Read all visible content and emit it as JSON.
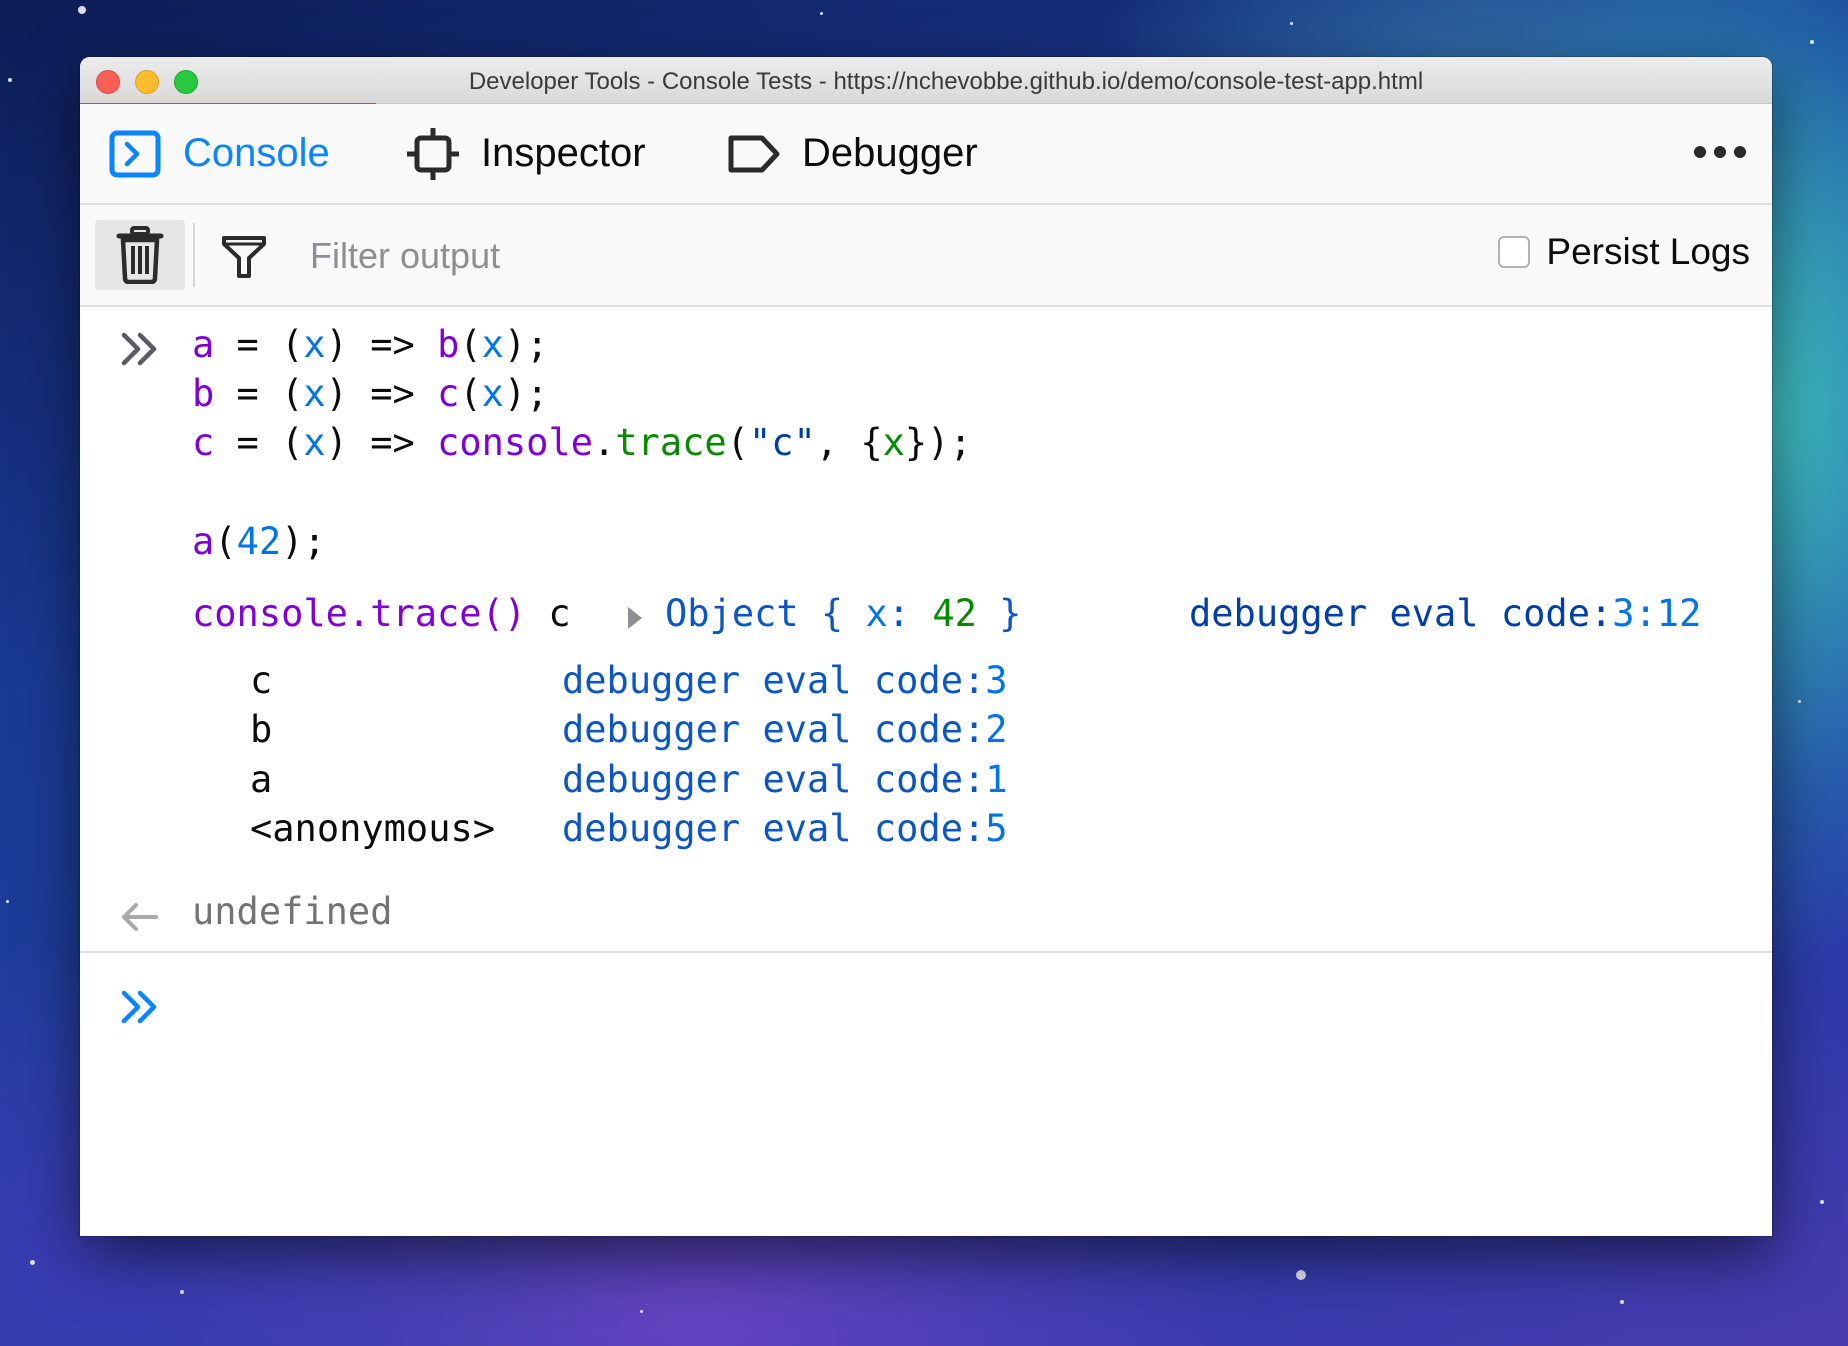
{
  "window": {
    "title": "Developer Tools - Console Tests - https://nchevobbe.github.io/demo/console-test-app.html"
  },
  "tabs": [
    {
      "label": "Console",
      "icon": "console-icon",
      "active": true
    },
    {
      "label": "Inspector",
      "icon": "inspector-icon",
      "active": false
    },
    {
      "label": "Debugger",
      "icon": "debugger-icon",
      "active": false
    }
  ],
  "toolbar": {
    "filter_placeholder": "Filter output",
    "persist_logs_label": "Persist Logs",
    "persist_logs_checked": false
  },
  "console": {
    "input_code": {
      "line1": {
        "lhs": "a",
        "eq": " = (",
        "param": "x",
        "arrow": ") => ",
        "fn": "b",
        "open": "(",
        "arg": "x",
        "close": ");"
      },
      "line2": {
        "lhs": "b",
        "eq": " = (",
        "param": "x",
        "arrow": ") => ",
        "fn": "c",
        "open": "(",
        "arg": "x",
        "close": ");"
      },
      "line3": {
        "lhs": "c",
        "eq": " = (",
        "param": "x",
        "arrow": ") => ",
        "fn": "console",
        "dot": ".",
        "method": "trace",
        "open": "(",
        "str": "\"c\"",
        "comma": ", {",
        "arg": "x",
        "close": "});"
      },
      "line4": {
        "fn": "a",
        "open": "(",
        "num": "42",
        "close": ");"
      }
    },
    "trace": {
      "label": "console.trace()",
      "message": "c",
      "object_prefix": "Object { ",
      "object_key": "x",
      "object_sep": ": ",
      "object_value": "42",
      "object_suffix": " }",
      "location_text": "debugger eval code:",
      "location_pos": "3:12",
      "frames": [
        {
          "name": "c",
          "location": "debugger eval code:",
          "line": "3"
        },
        {
          "name": "b",
          "location": "debugger eval code:",
          "line": "2"
        },
        {
          "name": "a",
          "location": "debugger eval code:",
          "line": "1"
        },
        {
          "name": "<anonymous>",
          "location": "debugger eval code:",
          "line": "5"
        }
      ]
    },
    "result": "undefined"
  },
  "colors": {
    "accent": "#0a84ff",
    "keyword": "#8000d7",
    "param": "#0074e8",
    "string_arg": "#058b00",
    "location": "#0b56c4"
  }
}
